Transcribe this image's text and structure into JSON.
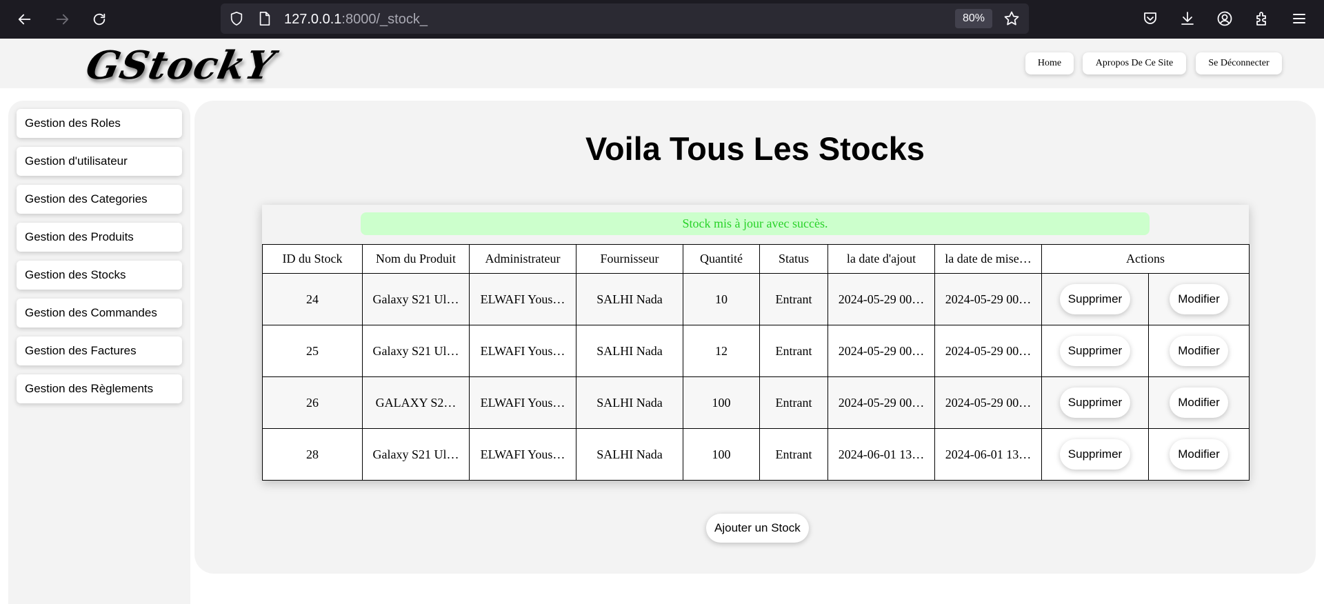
{
  "browser": {
    "url_host": "127.0.0.1",
    "url_path": ":8000/_stock_",
    "zoom": "80%"
  },
  "header": {
    "logo": "GStockY",
    "nav": [
      "Home",
      "Apropos De Ce Site",
      "Se Déconnecter"
    ]
  },
  "sidebar": {
    "items": [
      "Gestion des Roles",
      "Gestion d'utilisateur",
      "Gestion des Categories",
      "Gestion des Produits",
      "Gestion des Stocks",
      "Gestion des Commandes",
      "Gestion des Factures",
      "Gestion des Règlements"
    ]
  },
  "main": {
    "title": "Voila Tous Les Stocks",
    "alert": "Stock mis à jour avec succès.",
    "columns": [
      "ID du Stock",
      "Nom du Produit",
      "Administrateur",
      "Fournisseur",
      "Quantité",
      "Status",
      "la date d'ajout",
      "la date de mise…",
      "Actions"
    ],
    "rows": [
      {
        "id": "24",
        "product": "Galaxy S21 Ul…",
        "admin": "ELWAFI Yous…",
        "supplier": "SALHI Nada",
        "qty": "10",
        "status": "Entrant",
        "added": "2024-05-29 00…",
        "updated": "2024-05-29 00…"
      },
      {
        "id": "25",
        "product": "Galaxy S21 Ul…",
        "admin": "ELWAFI Yous…",
        "supplier": "SALHI Nada",
        "qty": "12",
        "status": "Entrant",
        "added": "2024-05-29 00…",
        "updated": "2024-05-29 00…"
      },
      {
        "id": "26",
        "product": "GALAXY S2…",
        "admin": "ELWAFI Yous…",
        "supplier": "SALHI Nada",
        "qty": "100",
        "status": "Entrant",
        "added": "2024-05-29 00…",
        "updated": "2024-05-29 00…"
      },
      {
        "id": "28",
        "product": "Galaxy S21 Ul…",
        "admin": "ELWAFI Yous…",
        "supplier": "SALHI Nada",
        "qty": "100",
        "status": "Entrant",
        "added": "2024-06-01 13…",
        "updated": "2024-06-01 13…"
      }
    ],
    "delete_label": "Supprimer",
    "edit_label": "Modifier",
    "add_label": "Ajouter un Stock"
  },
  "colors": {
    "chrome_bg": "#1c1b22",
    "urlbar_bg": "#2b2a33",
    "panel_bg": "#f3f3f3",
    "alert_bg": "#ccffcc",
    "alert_text": "#28d228"
  },
  "icons": [
    "back-icon",
    "forward-icon",
    "reload-icon",
    "shield-icon",
    "page-icon",
    "star-icon",
    "pocket-icon",
    "download-icon",
    "account-icon",
    "extensions-icon",
    "menu-icon"
  ]
}
